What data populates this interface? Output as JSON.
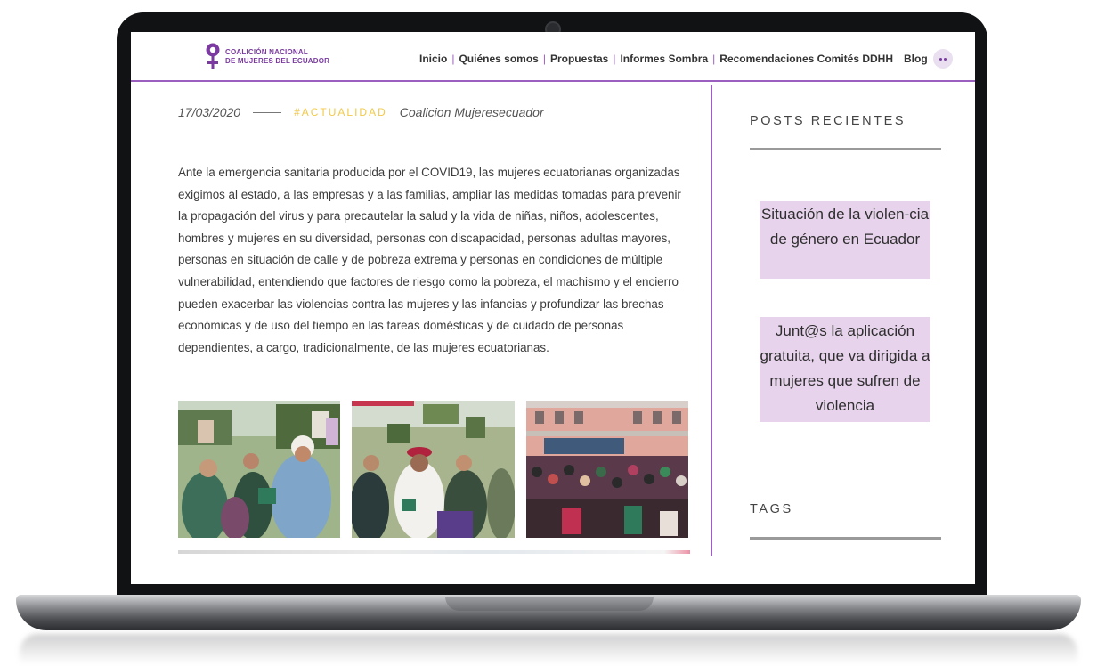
{
  "site": {
    "logo_name": "Coalición Nacional de Mujeres del Ecuador",
    "logo_line1": "COALICIÓN NACIONAL",
    "logo_line2": "DE MUJERES DEL ECUADOR"
  },
  "nav": {
    "items": [
      {
        "label": "Inicio"
      },
      {
        "label": "Quiénes somos"
      },
      {
        "label": "Propuestas"
      },
      {
        "label": "Informes Sombra"
      },
      {
        "label": "Recomendaciones Comités DDHH"
      },
      {
        "label": "Blog"
      }
    ],
    "more_icon": "more-dots-icon"
  },
  "article": {
    "date": "17/03/2020",
    "tag": "#ACTUALIDAD",
    "author": "Coalicion Mujeresecuador",
    "body": "Ante la emergencia sanitaria producida por el COVID19, las mujeres ecuatorianas organizadas exigimos al estado, a las empresas y a las familias, ampliar las medidas tomadas para prevenir la propagación del virus y para precautelar la salud y la vida de niñas, niños, adolescentes, hombres y mujeres en su diversidad, personas con discapacidad, personas adultas mayores, personas en situación de calle y de pobreza extrema y personas en condiciones de múltiple vulnerabilidad, entendiendo que factores de riesgo como la pobreza, el machismo y el encierro pueden exacerbar las violencias contra las mujeres y las infancias y profundizar las brechas económicas y de uso del tiempo en las tareas domésticas y de cuidado de personas dependientes, a cargo, tradicionalmente, de las mujeres ecuatorianas."
  },
  "sidebar": {
    "recent_heading": "POSTS RECIENTES",
    "posts": [
      {
        "title": "Situación de la violen-cia de género en Ecuador"
      },
      {
        "title": "Junt@s la aplicación gratuita, que va dirigida a mujeres que sufren de violencia"
      }
    ],
    "tags_heading": "TAGS"
  },
  "colors": {
    "accent": "#9b5fc0",
    "tag": "#f1c94a",
    "card": "#e7d3ec"
  }
}
